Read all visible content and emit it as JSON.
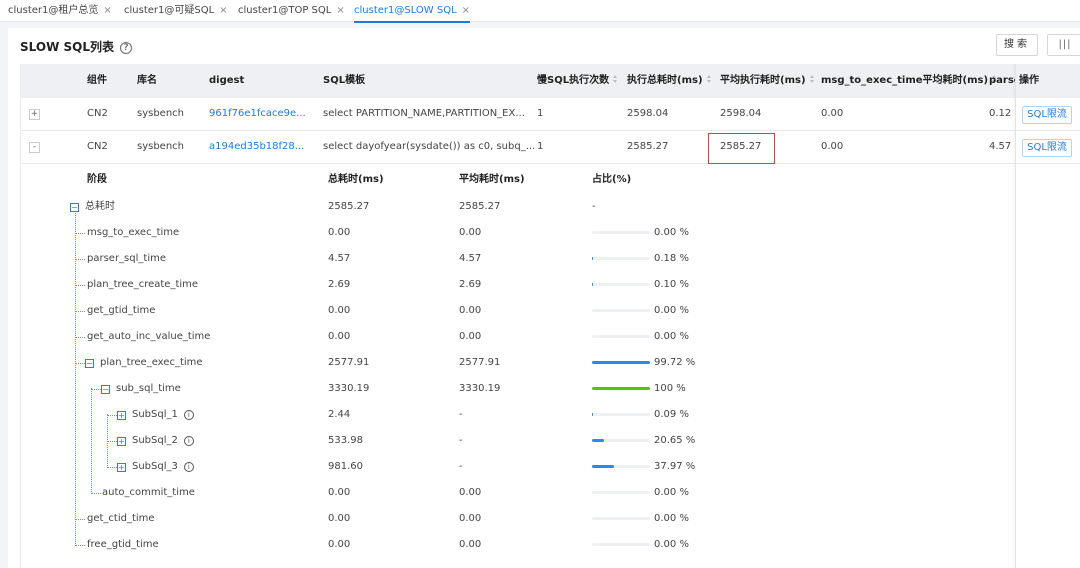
{
  "tabs": [
    {
      "label": "cluster1@租户总览",
      "close": "×"
    },
    {
      "label": "cluster1@可疑SQL",
      "close": "×"
    },
    {
      "label": "cluster1@TOP SQL",
      "close": "×"
    },
    {
      "label": "cluster1@SLOW SQL",
      "close": "×"
    }
  ],
  "header": {
    "title": "SLOW SQL列表",
    "help": "?"
  },
  "toolbar": {
    "search_label": "搜索",
    "columns_label": "|||"
  },
  "table": {
    "columns": [
      "组件",
      "库名",
      "digest",
      "SQL模板",
      "慢SQL执行次数",
      "执行总耗时(ms)",
      "平均执行耗时(ms)",
      "msg_to_exec_time平均耗时(ms)",
      "parser",
      "操作"
    ],
    "rows": [
      {
        "expand": "+",
        "component": "CN2",
        "db": "sysbench",
        "digest": "961f76e1fcace9e...",
        "sql": "select PARTITION_NAME,PARTITION_EX...",
        "count": "1",
        "total": "2598.04",
        "avg": "2598.04",
        "msg": "0.00",
        "parser": "0.12",
        "action": "SQL限流"
      },
      {
        "expand": "-",
        "component": "CN2",
        "db": "sysbench",
        "digest": "a194ed35b18f28...",
        "sql": "select dayofyear(sysdate()) as c0, subq_...",
        "count": "1",
        "total": "2585.27",
        "avg": "2585.27",
        "msg": "0.00",
        "parser": "4.57",
        "action": "SQL限流"
      }
    ]
  },
  "detail": {
    "headers": [
      "阶段",
      "总耗时(ms)",
      "平均耗时(ms)",
      "占比(%)"
    ],
    "rows": [
      {
        "name": "总耗时",
        "total": "2585.27",
        "avg": "2585.27",
        "pct": "-",
        "ratio": null
      },
      {
        "name": "msg_to_exec_time",
        "total": "0.00",
        "avg": "0.00",
        "pct": "0.00 %",
        "ratio": 0
      },
      {
        "name": "parser_sql_time",
        "total": "4.57",
        "avg": "4.57",
        "pct": "0.18 %",
        "ratio": 0.0018
      },
      {
        "name": "plan_tree_create_time",
        "total": "2.69",
        "avg": "2.69",
        "pct": "0.10 %",
        "ratio": 0.001
      },
      {
        "name": "get_gtid_time",
        "total": "0.00",
        "avg": "0.00",
        "pct": "0.00 %",
        "ratio": 0
      },
      {
        "name": "get_auto_inc_value_time",
        "total": "0.00",
        "avg": "0.00",
        "pct": "0.00 %",
        "ratio": 0
      },
      {
        "name": "plan_tree_exec_time",
        "total": "2577.91",
        "avg": "2577.91",
        "pct": "99.72 %",
        "ratio": 0.9972
      },
      {
        "name": "sub_sql_time",
        "total": "3330.19",
        "avg": "3330.19",
        "pct": "100 %",
        "ratio": 1.0
      },
      {
        "name": "SubSql_1",
        "total": "2.44",
        "avg": "-",
        "pct": "0.09 %",
        "ratio": 0.0009
      },
      {
        "name": "SubSql_2",
        "total": "533.98",
        "avg": "-",
        "pct": "20.65 %",
        "ratio": 0.2065
      },
      {
        "name": "SubSql_3",
        "total": "981.60",
        "avg": "-",
        "pct": "37.97 %",
        "ratio": 0.3797
      },
      {
        "name": "auto_commit_time",
        "total": "0.00",
        "avg": "0.00",
        "pct": "0.00 %",
        "ratio": 0
      },
      {
        "name": "get_ctid_time",
        "total": "0.00",
        "avg": "0.00",
        "pct": "0.00 %",
        "ratio": 0
      },
      {
        "name": "free_gtid_time",
        "total": "0.00",
        "avg": "0.00",
        "pct": "0.00 %",
        "ratio": 0
      }
    ]
  },
  "colors": {
    "accent": "#1f7ae0",
    "bar_blue": "#2b8ae6",
    "bar_green": "#52c41a",
    "highlight": "#e33a3a"
  }
}
